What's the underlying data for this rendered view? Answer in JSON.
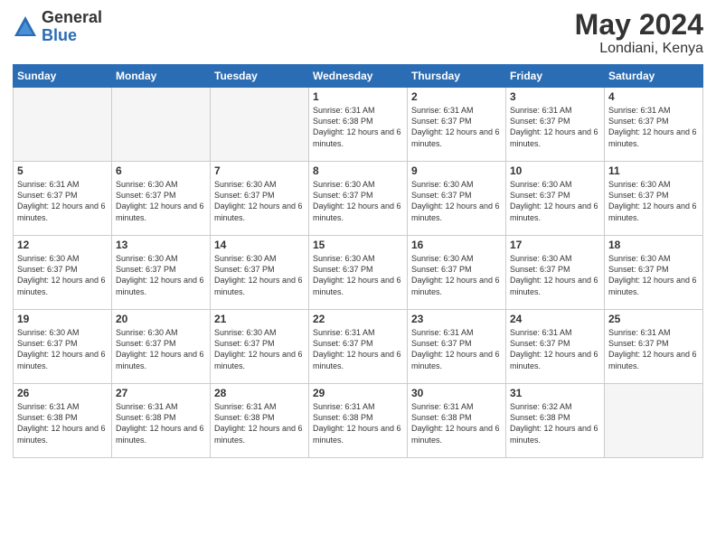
{
  "logo": {
    "general": "General",
    "blue": "Blue"
  },
  "title": {
    "month_year": "May 2024",
    "location": "Londiani, Kenya"
  },
  "weekdays": [
    "Sunday",
    "Monday",
    "Tuesday",
    "Wednesday",
    "Thursday",
    "Friday",
    "Saturday"
  ],
  "weeks": [
    [
      {
        "day": "",
        "sunrise": "",
        "sunset": "",
        "daylight": ""
      },
      {
        "day": "",
        "sunrise": "",
        "sunset": "",
        "daylight": ""
      },
      {
        "day": "",
        "sunrise": "",
        "sunset": "",
        "daylight": ""
      },
      {
        "day": "1",
        "sunrise": "Sunrise: 6:31 AM",
        "sunset": "Sunset: 6:38 PM",
        "daylight": "Daylight: 12 hours and 6 minutes."
      },
      {
        "day": "2",
        "sunrise": "Sunrise: 6:31 AM",
        "sunset": "Sunset: 6:37 PM",
        "daylight": "Daylight: 12 hours and 6 minutes."
      },
      {
        "day": "3",
        "sunrise": "Sunrise: 6:31 AM",
        "sunset": "Sunset: 6:37 PM",
        "daylight": "Daylight: 12 hours and 6 minutes."
      },
      {
        "day": "4",
        "sunrise": "Sunrise: 6:31 AM",
        "sunset": "Sunset: 6:37 PM",
        "daylight": "Daylight: 12 hours and 6 minutes."
      }
    ],
    [
      {
        "day": "5",
        "sunrise": "Sunrise: 6:31 AM",
        "sunset": "Sunset: 6:37 PM",
        "daylight": "Daylight: 12 hours and 6 minutes."
      },
      {
        "day": "6",
        "sunrise": "Sunrise: 6:30 AM",
        "sunset": "Sunset: 6:37 PM",
        "daylight": "Daylight: 12 hours and 6 minutes."
      },
      {
        "day": "7",
        "sunrise": "Sunrise: 6:30 AM",
        "sunset": "Sunset: 6:37 PM",
        "daylight": "Daylight: 12 hours and 6 minutes."
      },
      {
        "day": "8",
        "sunrise": "Sunrise: 6:30 AM",
        "sunset": "Sunset: 6:37 PM",
        "daylight": "Daylight: 12 hours and 6 minutes."
      },
      {
        "day": "9",
        "sunrise": "Sunrise: 6:30 AM",
        "sunset": "Sunset: 6:37 PM",
        "daylight": "Daylight: 12 hours and 6 minutes."
      },
      {
        "day": "10",
        "sunrise": "Sunrise: 6:30 AM",
        "sunset": "Sunset: 6:37 PM",
        "daylight": "Daylight: 12 hours and 6 minutes."
      },
      {
        "day": "11",
        "sunrise": "Sunrise: 6:30 AM",
        "sunset": "Sunset: 6:37 PM",
        "daylight": "Daylight: 12 hours and 6 minutes."
      }
    ],
    [
      {
        "day": "12",
        "sunrise": "Sunrise: 6:30 AM",
        "sunset": "Sunset: 6:37 PM",
        "daylight": "Daylight: 12 hours and 6 minutes."
      },
      {
        "day": "13",
        "sunrise": "Sunrise: 6:30 AM",
        "sunset": "Sunset: 6:37 PM",
        "daylight": "Daylight: 12 hours and 6 minutes."
      },
      {
        "day": "14",
        "sunrise": "Sunrise: 6:30 AM",
        "sunset": "Sunset: 6:37 PM",
        "daylight": "Daylight: 12 hours and 6 minutes."
      },
      {
        "day": "15",
        "sunrise": "Sunrise: 6:30 AM",
        "sunset": "Sunset: 6:37 PM",
        "daylight": "Daylight: 12 hours and 6 minutes."
      },
      {
        "day": "16",
        "sunrise": "Sunrise: 6:30 AM",
        "sunset": "Sunset: 6:37 PM",
        "daylight": "Daylight: 12 hours and 6 minutes."
      },
      {
        "day": "17",
        "sunrise": "Sunrise: 6:30 AM",
        "sunset": "Sunset: 6:37 PM",
        "daylight": "Daylight: 12 hours and 6 minutes."
      },
      {
        "day": "18",
        "sunrise": "Sunrise: 6:30 AM",
        "sunset": "Sunset: 6:37 PM",
        "daylight": "Daylight: 12 hours and 6 minutes."
      }
    ],
    [
      {
        "day": "19",
        "sunrise": "Sunrise: 6:30 AM",
        "sunset": "Sunset: 6:37 PM",
        "daylight": "Daylight: 12 hours and 6 minutes."
      },
      {
        "day": "20",
        "sunrise": "Sunrise: 6:30 AM",
        "sunset": "Sunset: 6:37 PM",
        "daylight": "Daylight: 12 hours and 6 minutes."
      },
      {
        "day": "21",
        "sunrise": "Sunrise: 6:30 AM",
        "sunset": "Sunset: 6:37 PM",
        "daylight": "Daylight: 12 hours and 6 minutes."
      },
      {
        "day": "22",
        "sunrise": "Sunrise: 6:31 AM",
        "sunset": "Sunset: 6:37 PM",
        "daylight": "Daylight: 12 hours and 6 minutes."
      },
      {
        "day": "23",
        "sunrise": "Sunrise: 6:31 AM",
        "sunset": "Sunset: 6:37 PM",
        "daylight": "Daylight: 12 hours and 6 minutes."
      },
      {
        "day": "24",
        "sunrise": "Sunrise: 6:31 AM",
        "sunset": "Sunset: 6:37 PM",
        "daylight": "Daylight: 12 hours and 6 minutes."
      },
      {
        "day": "25",
        "sunrise": "Sunrise: 6:31 AM",
        "sunset": "Sunset: 6:37 PM",
        "daylight": "Daylight: 12 hours and 6 minutes."
      }
    ],
    [
      {
        "day": "26",
        "sunrise": "Sunrise: 6:31 AM",
        "sunset": "Sunset: 6:38 PM",
        "daylight": "Daylight: 12 hours and 6 minutes."
      },
      {
        "day": "27",
        "sunrise": "Sunrise: 6:31 AM",
        "sunset": "Sunset: 6:38 PM",
        "daylight": "Daylight: 12 hours and 6 minutes."
      },
      {
        "day": "28",
        "sunrise": "Sunrise: 6:31 AM",
        "sunset": "Sunset: 6:38 PM",
        "daylight": "Daylight: 12 hours and 6 minutes."
      },
      {
        "day": "29",
        "sunrise": "Sunrise: 6:31 AM",
        "sunset": "Sunset: 6:38 PM",
        "daylight": "Daylight: 12 hours and 6 minutes."
      },
      {
        "day": "30",
        "sunrise": "Sunrise: 6:31 AM",
        "sunset": "Sunset: 6:38 PM",
        "daylight": "Daylight: 12 hours and 6 minutes."
      },
      {
        "day": "31",
        "sunrise": "Sunrise: 6:32 AM",
        "sunset": "Sunset: 6:38 PM",
        "daylight": "Daylight: 12 hours and 6 minutes."
      },
      {
        "day": "",
        "sunrise": "",
        "sunset": "",
        "daylight": ""
      }
    ]
  ]
}
